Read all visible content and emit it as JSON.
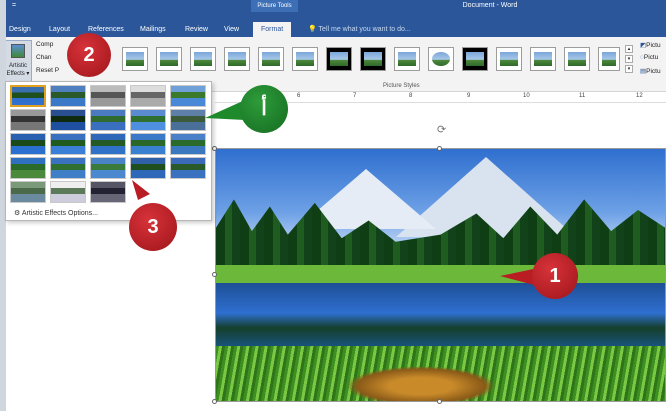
{
  "title_bar": {
    "picture_tools": "Picture Tools",
    "document_title": "Document - Word",
    "qat_symbol": "="
  },
  "tabs": [
    "Design",
    "Layout",
    "References",
    "Mailings",
    "Review",
    "View",
    "Format"
  ],
  "active_tab": "Format",
  "tell_me": "Tell me what you want to do...",
  "ribbon": {
    "artistic_effects": "Artistic Effects",
    "adjust_items": [
      "Comp",
      "Chan",
      "Reset P"
    ],
    "picture_styles_label": "Picture Styles",
    "right_commands": [
      "Pictu",
      "Pictu",
      "Pictu"
    ]
  },
  "ruler_ticks": [
    "6",
    "7",
    "8",
    "9",
    "10",
    "11",
    "12"
  ],
  "dropdown": {
    "options_label": "Artistic Effects Options..."
  },
  "callouts": {
    "one": "1",
    "two": "2",
    "three": "3",
    "alif": "أ"
  },
  "colors": {
    "word_blue": "#2b579a",
    "callout_red": "#b91d23",
    "callout_green": "#1e8a2c",
    "selected_border": "#e0a020"
  }
}
